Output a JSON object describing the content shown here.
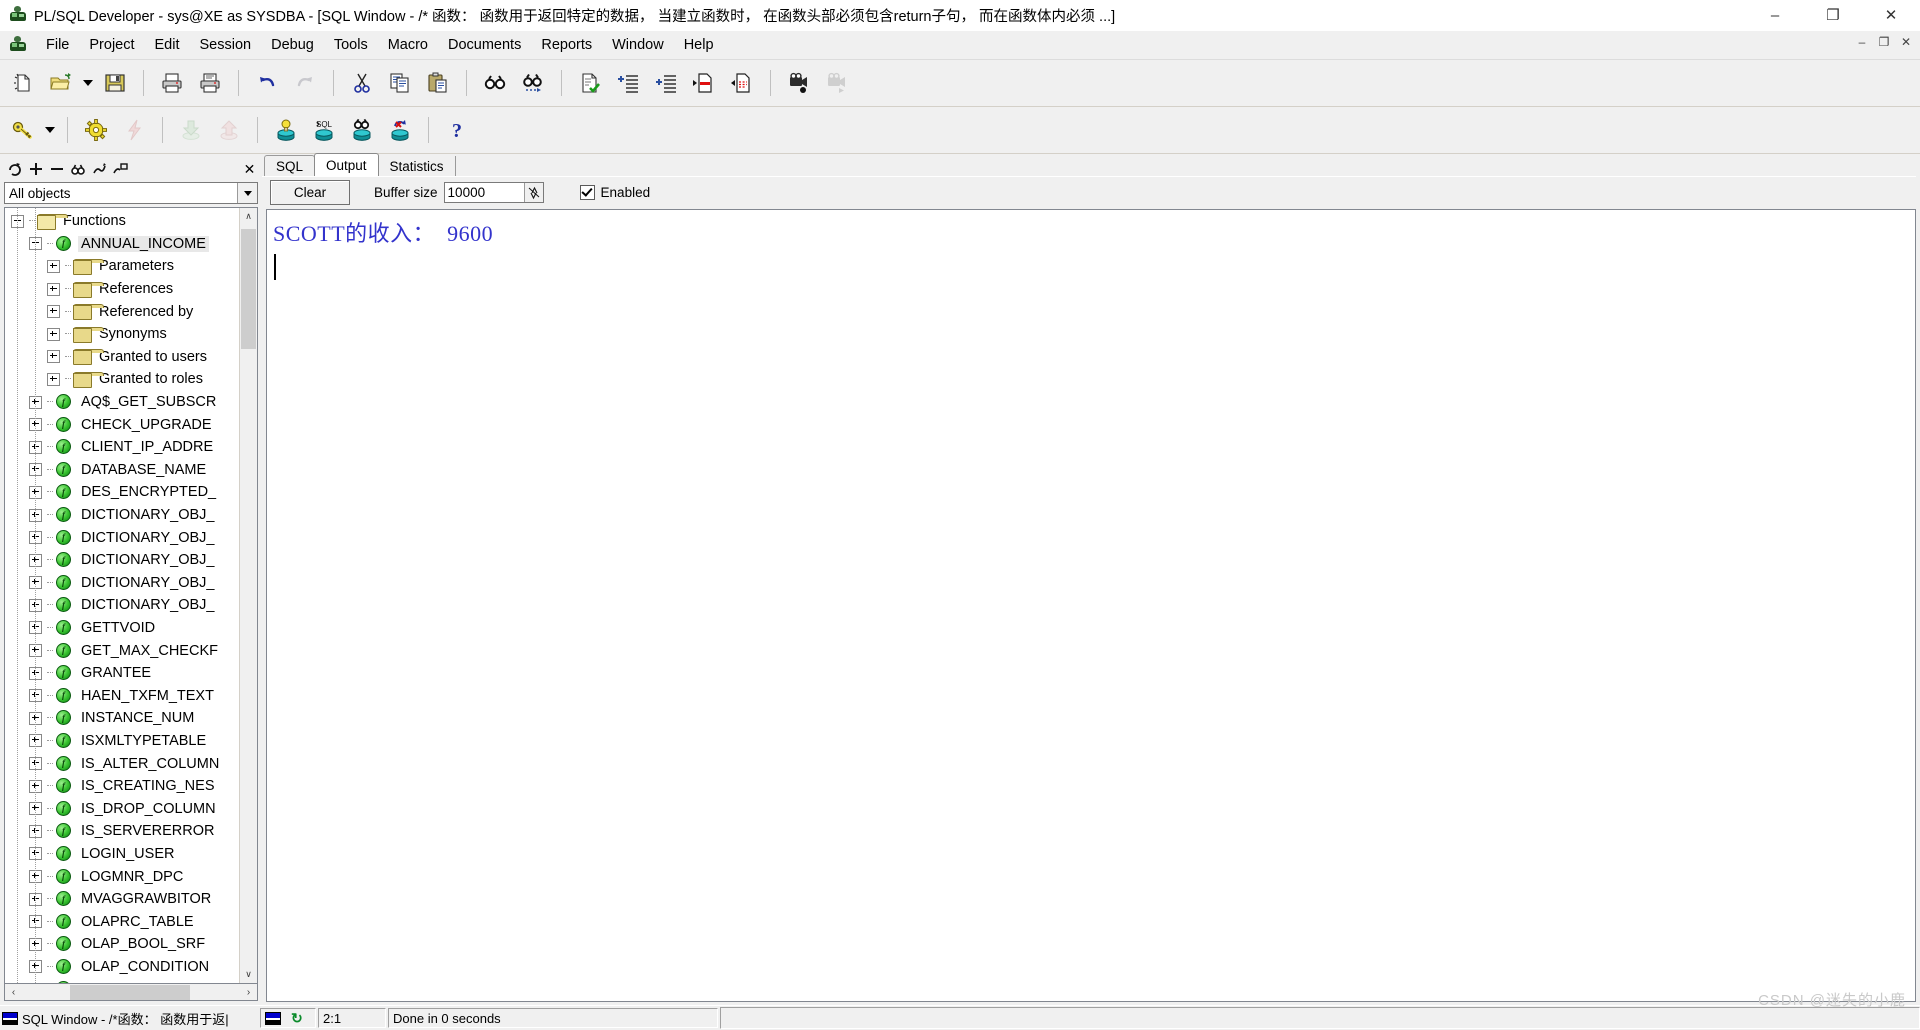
{
  "window": {
    "title": "PL/SQL Developer - sys@XE as SYSDBA - [SQL Window - /* 函数： 函数用于返回特定的数据，  当建立函数时，  在函数头部必须包含return子句， 而在函数体内必须 ...]",
    "app_icon": "plsql-developer-icon",
    "minimize": "–",
    "maximize": "❐",
    "close": "✕",
    "mdi_minimize": "–",
    "mdi_restore": "❐",
    "mdi_close": "✕"
  },
  "menu": {
    "items": [
      {
        "label": "File"
      },
      {
        "label": "Project"
      },
      {
        "label": "Edit"
      },
      {
        "label": "Session"
      },
      {
        "label": "Debug"
      },
      {
        "label": "Tools"
      },
      {
        "label": "Macro"
      },
      {
        "label": "Documents"
      },
      {
        "label": "Reports"
      },
      {
        "label": "Window"
      },
      {
        "label": "Help"
      }
    ]
  },
  "toolbar_main": {
    "buttons": [
      {
        "name": "new-icon",
        "glyph": "❐",
        "disabled": false
      },
      {
        "name": "open-folder-icon",
        "glyph": "📂",
        "disabled": false
      },
      {
        "name": "open-dropdown-arrow-icon",
        "glyph": "▾",
        "disabled": false
      },
      {
        "name": "save-icon",
        "glyph": "💾",
        "disabled": false
      },
      {
        "name": "print-icon",
        "glyph": "🖨",
        "disabled": false
      },
      {
        "name": "print-preview-icon",
        "glyph": "🖨",
        "disabled": false
      },
      {
        "name": "undo-icon",
        "glyph": "↶",
        "disabled": false
      },
      {
        "name": "redo-icon",
        "glyph": "↷",
        "disabled": true
      },
      {
        "name": "cut-icon",
        "glyph": "✂",
        "disabled": false
      },
      {
        "name": "copy-icon",
        "glyph": "⧉",
        "disabled": false
      },
      {
        "name": "paste-icon",
        "glyph": "📋",
        "disabled": false
      },
      {
        "name": "find-icon",
        "glyph": "🔍",
        "disabled": false
      },
      {
        "name": "find-next-icon",
        "glyph": "🔎",
        "disabled": false
      },
      {
        "name": "check-syntax-icon",
        "glyph": "✔",
        "disabled": false
      },
      {
        "name": "indent-icon",
        "glyph": "⇥",
        "disabled": false
      },
      {
        "name": "outdent-icon",
        "glyph": "⇤",
        "disabled": false
      },
      {
        "name": "comment-icon",
        "glyph": "▶",
        "disabled": false
      },
      {
        "name": "uncomment-icon",
        "glyph": "◀",
        "disabled": false
      },
      {
        "name": "record-macro-icon",
        "glyph": "🎥",
        "disabled": false
      },
      {
        "name": "play-macro-icon",
        "glyph": "🎥",
        "disabled": true
      }
    ]
  },
  "toolbar_session": {
    "buttons": [
      {
        "name": "login-key-icon",
        "glyph": "🗝",
        "disabled": false
      },
      {
        "name": "login-dropdown-arrow-icon",
        "glyph": "▾",
        "disabled": false
      },
      {
        "name": "session-gear-icon",
        "glyph": "⚙",
        "disabled": false
      },
      {
        "name": "break-session-icon",
        "glyph": "⚡",
        "disabled": true
      },
      {
        "name": "commit-icon",
        "glyph": "⬇",
        "disabled": true
      },
      {
        "name": "rollback-icon",
        "glyph": "⬆",
        "disabled": true
      },
      {
        "name": "explain-plan-icon",
        "glyph": "💡",
        "disabled": false
      },
      {
        "name": "sql-window-icon",
        "glyph": "SQL",
        "disabled": false
      },
      {
        "name": "find-database-objects-icon",
        "glyph": "🔍",
        "disabled": false
      },
      {
        "name": "recompile-invalid-objects-icon",
        "glyph": "↺",
        "disabled": false
      },
      {
        "name": "help-icon",
        "glyph": "?",
        "disabled": false
      }
    ]
  },
  "browser": {
    "toolbar": [
      {
        "name": "refresh-icon",
        "glyph": "⟳"
      },
      {
        "name": "expand-all-icon",
        "glyph": "➕"
      },
      {
        "name": "collapse-all-icon",
        "glyph": "➖"
      },
      {
        "name": "find-object-icon",
        "glyph": "🔍"
      },
      {
        "name": "filter-objects-icon",
        "glyph": "⑂"
      },
      {
        "name": "browser-folders-icon",
        "glyph": "⑁"
      },
      {
        "name": "close-browser-icon",
        "glyph": "✕"
      }
    ],
    "filter": {
      "value": "All objects",
      "placeholder": "All objects"
    },
    "tree": [
      {
        "label": "Functions",
        "icon": "folder-open-icon",
        "indent": 0,
        "expander": "minus",
        "selected": false
      },
      {
        "label": "ANNUAL_INCOME",
        "icon": "function-icon",
        "indent": 1,
        "expander": "minus",
        "selected": true
      },
      {
        "label": "Parameters",
        "icon": "folder-icon",
        "indent": 2,
        "expander": "plus",
        "selected": false
      },
      {
        "label": "References",
        "icon": "folder-icon",
        "indent": 2,
        "expander": "plus",
        "selected": false
      },
      {
        "label": "Referenced by",
        "icon": "folder-icon",
        "indent": 2,
        "expander": "plus",
        "selected": false
      },
      {
        "label": "Synonyms",
        "icon": "folder-icon",
        "indent": 2,
        "expander": "plus",
        "selected": false
      },
      {
        "label": "Granted to users",
        "icon": "folder-icon",
        "indent": 2,
        "expander": "plus",
        "selected": false
      },
      {
        "label": "Granted to roles",
        "icon": "folder-icon",
        "indent": 2,
        "expander": "plus",
        "selected": false
      },
      {
        "label": "AQ$_GET_SUBSCR",
        "icon": "function-icon",
        "indent": 1,
        "expander": "plus",
        "selected": false
      },
      {
        "label": "CHECK_UPGRADE",
        "icon": "function-icon",
        "indent": 1,
        "expander": "plus",
        "selected": false
      },
      {
        "label": "CLIENT_IP_ADDRE",
        "icon": "function-icon",
        "indent": 1,
        "expander": "plus",
        "selected": false
      },
      {
        "label": "DATABASE_NAME",
        "icon": "function-icon",
        "indent": 1,
        "expander": "plus",
        "selected": false
      },
      {
        "label": "DES_ENCRYPTED_",
        "icon": "function-icon",
        "indent": 1,
        "expander": "plus",
        "selected": false
      },
      {
        "label": "DICTIONARY_OBJ_",
        "icon": "function-icon",
        "indent": 1,
        "expander": "plus",
        "selected": false
      },
      {
        "label": "DICTIONARY_OBJ_",
        "icon": "function-icon",
        "indent": 1,
        "expander": "plus",
        "selected": false
      },
      {
        "label": "DICTIONARY_OBJ_",
        "icon": "function-icon",
        "indent": 1,
        "expander": "plus",
        "selected": false
      },
      {
        "label": "DICTIONARY_OBJ_",
        "icon": "function-icon",
        "indent": 1,
        "expander": "plus",
        "selected": false
      },
      {
        "label": "DICTIONARY_OBJ_",
        "icon": "function-icon",
        "indent": 1,
        "expander": "plus",
        "selected": false
      },
      {
        "label": "GETTVOID",
        "icon": "function-icon",
        "indent": 1,
        "expander": "plus",
        "selected": false
      },
      {
        "label": "GET_MAX_CHECKF",
        "icon": "function-icon",
        "indent": 1,
        "expander": "plus",
        "selected": false
      },
      {
        "label": "GRANTEE",
        "icon": "function-icon",
        "indent": 1,
        "expander": "plus",
        "selected": false
      },
      {
        "label": "HAEN_TXFM_TEXT",
        "icon": "function-icon",
        "indent": 1,
        "expander": "plus",
        "selected": false
      },
      {
        "label": "INSTANCE_NUM",
        "icon": "function-icon",
        "indent": 1,
        "expander": "plus",
        "selected": false
      },
      {
        "label": "ISXMLTYPETABLE",
        "icon": "function-icon",
        "indent": 1,
        "expander": "plus",
        "selected": false
      },
      {
        "label": "IS_ALTER_COLUMN",
        "icon": "function-icon",
        "indent": 1,
        "expander": "plus",
        "selected": false
      },
      {
        "label": "IS_CREATING_NES",
        "icon": "function-icon",
        "indent": 1,
        "expander": "plus",
        "selected": false
      },
      {
        "label": "IS_DROP_COLUMN",
        "icon": "function-icon",
        "indent": 1,
        "expander": "plus",
        "selected": false
      },
      {
        "label": "IS_SERVERERROR",
        "icon": "function-icon",
        "indent": 1,
        "expander": "plus",
        "selected": false
      },
      {
        "label": "LOGIN_USER",
        "icon": "function-icon",
        "indent": 1,
        "expander": "plus",
        "selected": false
      },
      {
        "label": "LOGMNR_DPC",
        "icon": "function-icon",
        "indent": 1,
        "expander": "plus",
        "selected": false
      },
      {
        "label": "MVAGGRAWBITOR",
        "icon": "function-icon",
        "indent": 1,
        "expander": "plus",
        "selected": false
      },
      {
        "label": "OLAPRC_TABLE",
        "icon": "function-icon",
        "indent": 1,
        "expander": "plus",
        "selected": false
      },
      {
        "label": "OLAP_BOOL_SRF",
        "icon": "function-icon",
        "indent": 1,
        "expander": "plus",
        "selected": false
      },
      {
        "label": "OLAP_CONDITION",
        "icon": "function-icon",
        "indent": 1,
        "expander": "plus",
        "selected": false
      },
      {
        "label": "OLAP_DATE_SRF",
        "icon": "function-icon",
        "indent": 1,
        "expander": "plus",
        "selected": false
      }
    ],
    "scroll_up_glyph": "∧",
    "scroll_down_glyph": "∨",
    "scroll_left_glyph": "‹",
    "scroll_right_glyph": "›"
  },
  "document": {
    "tabs": [
      {
        "label": "SQL",
        "active": false
      },
      {
        "label": "Output",
        "active": true
      },
      {
        "label": "Statistics",
        "active": false
      }
    ],
    "output_toolbar": {
      "clear_label": "Clear",
      "buffer_label": "Buffer size",
      "buffer_value": "10000",
      "spinner_glyph": "⇅",
      "enabled_label": "Enabled",
      "enabled_checked": true
    },
    "output_text": "SCOTT的收入：  9600"
  },
  "statusbar": {
    "document": "SQL Window - /*函数： 函数用于返|",
    "session_icon": "session-window-icon",
    "refresh_icon": "↻",
    "position": "2:1",
    "message": "Done in 0 seconds"
  },
  "watermark": "CSDN @迷失的小鹿",
  "colors": {
    "window_bg": "#f0f0f0",
    "panel_bg": "#ffffff",
    "output_text": "#3333cc",
    "accent": "#0a5a10",
    "selection": "#e8e8e8"
  }
}
